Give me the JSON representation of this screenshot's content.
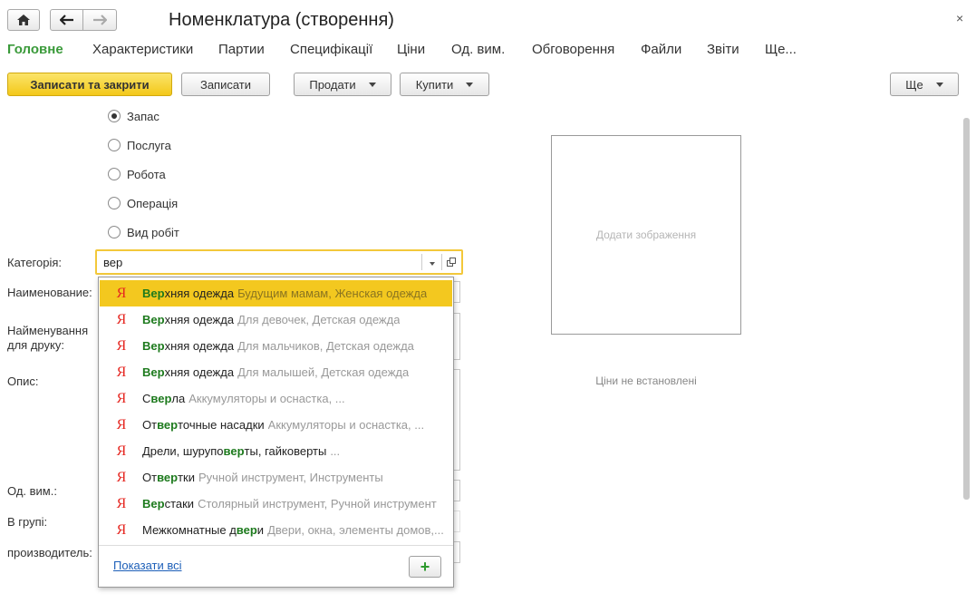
{
  "window": {
    "title": "Номенклатура (створення)"
  },
  "tabs": [
    "Головне",
    "Характеристики",
    "Партии",
    "Специфікації",
    "Ціни",
    "Од. вим.",
    "Обговорення",
    "Файли",
    "Звіти",
    "Ще..."
  ],
  "toolbar": {
    "save_close": "Записати та закрити",
    "save": "Записати",
    "sell": "Продати",
    "buy": "Купити",
    "more": "Ще"
  },
  "item_type": {
    "options": [
      "Запас",
      "Послуга",
      "Робота",
      "Операція",
      "Вид робіт"
    ],
    "selected": "Запас"
  },
  "form": {
    "category_label": "Категорія:",
    "category_value": "вер",
    "name_label": "Наименование:",
    "print_name_label_1": "Найменування",
    "print_name_label_2": "для друку:",
    "description_label": "Опис:",
    "unit_label": "Од. вим.:",
    "group_label": "В групі:",
    "manufacturer_label": "производитель:"
  },
  "suggestions": {
    "items": [
      {
        "pre": "",
        "hl": "Вер",
        "post": "хняя одежда",
        "sub": "Будущим мамам, Женская одежда"
      },
      {
        "pre": "",
        "hl": "Вер",
        "post": "хняя одежда",
        "sub": "Для девочек, Детская одежда"
      },
      {
        "pre": "",
        "hl": "Вер",
        "post": "хняя одежда",
        "sub": "Для мальчиков, Детская одежда"
      },
      {
        "pre": "",
        "hl": "Вер",
        "post": "хняя одежда",
        "sub": "Для малышей, Детская одежда"
      },
      {
        "pre": "С",
        "hl": "вер",
        "post": "ла",
        "sub": "Аккумуляторы и оснастка, ..."
      },
      {
        "pre": "От",
        "hl": "вер",
        "post": "точные насадки",
        "sub": "Аккумуляторы и оснастка, ..."
      },
      {
        "pre": "Дрели, шурупо",
        "hl": "вер",
        "post": "ты, гайковерты",
        "sub": "..."
      },
      {
        "pre": "От",
        "hl": "вер",
        "post": "тки",
        "sub": "Ручной инструмент, Инструменты"
      },
      {
        "pre": "",
        "hl": "Вер",
        "post": "стаки",
        "sub": "Столярный инструмент, Ручной инструмент"
      },
      {
        "pre": "Межкомнатные д",
        "hl": "вер",
        "post": "и",
        "sub": "Двери, окна, элементы домов,..."
      }
    ],
    "selected_index": 0,
    "icon_glyph": "Я",
    "show_all": "Показати всі",
    "add_glyph": "+"
  },
  "image": {
    "placeholder": "Додати зображення"
  },
  "prices": {
    "status": "Ціни не встановлені"
  },
  "close_glyph": "×"
}
